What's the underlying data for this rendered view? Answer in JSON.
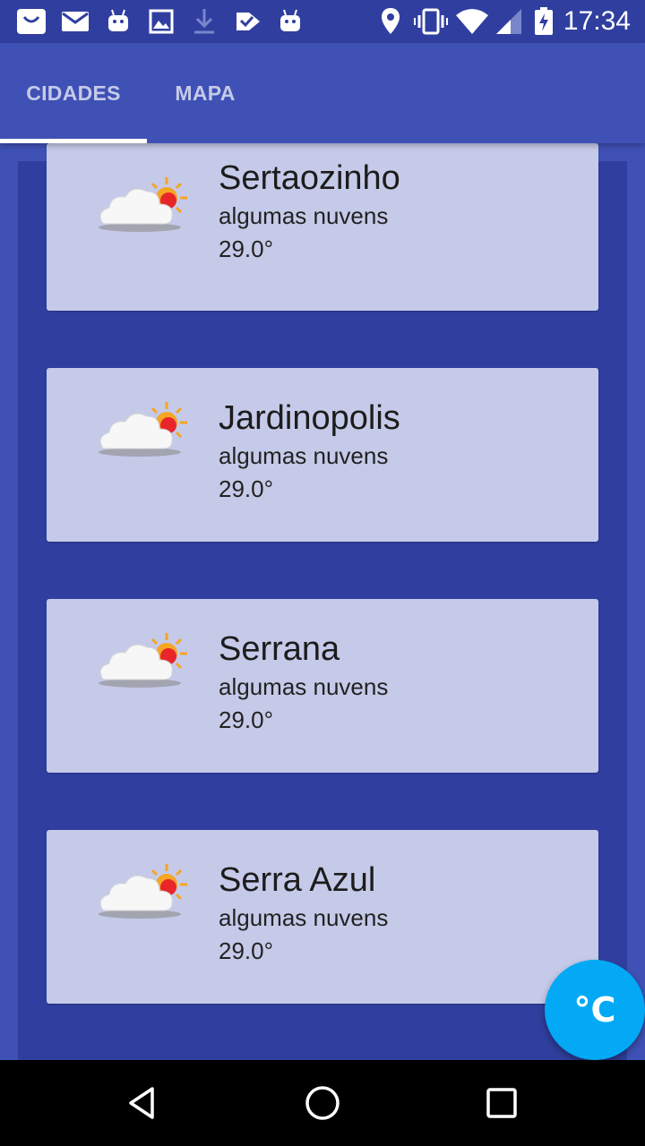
{
  "status_bar": {
    "time": "17:34",
    "left_icons": [
      "shopping-bag-icon",
      "mail-icon",
      "android-icon",
      "image-icon",
      "download-icon",
      "check-badge-icon",
      "android-icon"
    ],
    "right_icons": [
      "location-icon",
      "vibrate-icon",
      "wifi-icon",
      "signal-icon",
      "battery-charging-icon"
    ]
  },
  "tabs": [
    {
      "label": "CIDADES",
      "selected": true
    },
    {
      "label": "MAPA",
      "selected": false
    }
  ],
  "cities": [
    {
      "name": "Sertaozinho",
      "description": "algumas nuvens",
      "temperature": "29.0°",
      "icon": "partly-cloudy-icon"
    },
    {
      "name": "Jardinopolis",
      "description": "algumas nuvens",
      "temperature": "29.0°",
      "icon": "partly-cloudy-icon"
    },
    {
      "name": "Serrana",
      "description": "algumas nuvens",
      "temperature": "29.0°",
      "icon": "partly-cloudy-icon"
    },
    {
      "name": "Serra Azul",
      "description": "algumas nuvens",
      "temperature": "29.0°",
      "icon": "partly-cloudy-icon"
    }
  ],
  "fab": {
    "label": "°C"
  },
  "nav_bar": {
    "buttons": [
      "back-icon",
      "home-icon",
      "recents-icon"
    ]
  },
  "colors": {
    "primary": "#3f51b5",
    "primary_dark": "#303f9f",
    "card": "#c5cae9",
    "fab": "#03a9f4",
    "tab_indicator": "#ffffff"
  }
}
